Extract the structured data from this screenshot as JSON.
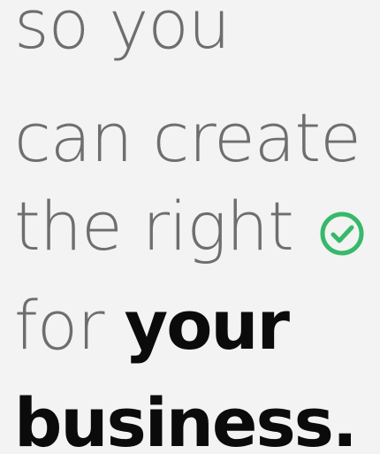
{
  "text": {
    "line1": "so you",
    "line2": "can create",
    "line3": "the right",
    "line4_prefix": "for ",
    "line4_bold": "your",
    "line5": "business."
  },
  "icon": {
    "name": "check-circle-icon",
    "color": "#36b96a"
  },
  "colors": {
    "background": "#f3f3f3",
    "light_text": "#6e6e6e",
    "bold_text": "#0b0b0b"
  }
}
